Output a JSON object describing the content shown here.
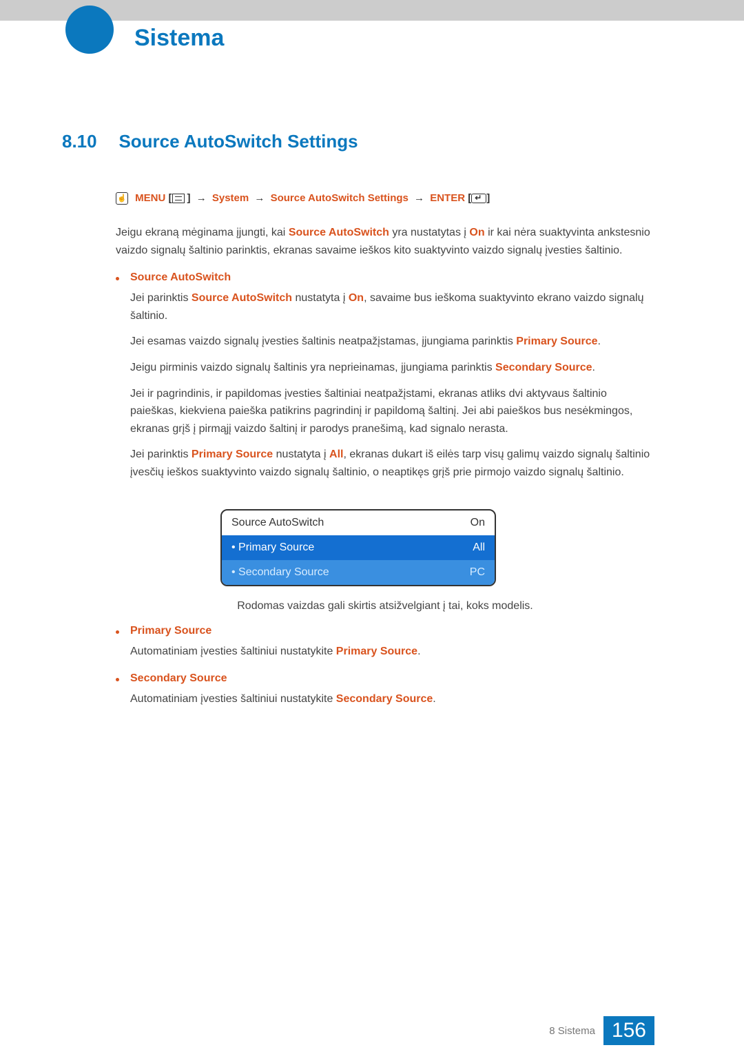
{
  "chapter_title": "Sistema",
  "section": {
    "number": "8.10",
    "title": "Source AutoSwitch Settings"
  },
  "breadcrumb": {
    "menu": "MENU",
    "system": "System",
    "settings": "Source AutoSwitch Settings",
    "enter": "ENTER"
  },
  "intro": {
    "t1a": "Jeigu ekraną mėginama įjungti, kai ",
    "t1b": "Source AutoSwitch",
    "t1c": " yra nustatytas į ",
    "t1d": "On",
    "t1e": " ir kai nėra suaktyvinta ankstesnio vaizdo signalų šaltinio parinktis, ekranas savaime ieškos kito suaktyvinto vaizdo signalų įvesties šaltinio."
  },
  "bullet1": {
    "title": "Source AutoSwitch",
    "p1a": "Jei parinktis ",
    "p1b": "Source AutoSwitch",
    "p1c": " nustatyta į ",
    "p1d": "On",
    "p1e": ", savaime bus ieškoma suaktyvinto ekrano vaizdo signalų šaltinio.",
    "p2a": "Jei esamas vaizdo signalų įvesties šaltinis neatpažįstamas, įjungiama parinktis ",
    "p2b": "Primary Source",
    "p2c": ".",
    "p3a": "Jeigu pirminis vaizdo signalų šaltinis yra neprieinamas, įjungiama parinktis ",
    "p3b": "Secondary Source",
    "p3c": ".",
    "p4": "Jei ir pagrindinis, ir papildomas įvesties šaltiniai neatpažįstami, ekranas atliks dvi aktyvaus šaltinio paieškas, kiekviena paieška patikrins pagrindinį ir papildomą šaltinį. Jei abi paieškos bus nesėkmingos, ekranas grįš į pirmąjį vaizdo šaltinį ir parodys pranešimą, kad signalo nerasta.",
    "p5a": "Jei parinktis ",
    "p5b": "Primary Source",
    "p5c": " nustatyta į ",
    "p5d": "All",
    "p5e": ", ekranas dukart iš eilės tarp visų galimų vaizdo signalų šaltinio įvesčių ieškos suaktyvinto vaizdo signalų šaltinio, o neaptikęs grįš prie pirmojo vaizdo signalų šaltinio."
  },
  "osd": {
    "row1": {
      "label": "Source AutoSwitch",
      "value": "On"
    },
    "row2": {
      "label": "• Primary Source",
      "value": "All"
    },
    "row3": {
      "label": "• Secondary Source",
      "value": "PC"
    }
  },
  "caption": "Rodomas vaizdas gali skirtis atsižvelgiant į tai, koks modelis.",
  "bullet2": {
    "title": "Primary Source",
    "p1a": "Automatiniam įvesties šaltiniui nustatykite ",
    "p1b": "Primary Source",
    "p1c": "."
  },
  "bullet3": {
    "title": "Secondary Source",
    "p1a": "Automatiniam įvesties šaltiniui nustatykite ",
    "p1b": "Secondary Source",
    "p1c": "."
  },
  "footer": {
    "label": "8 Sistema",
    "page": "156"
  }
}
